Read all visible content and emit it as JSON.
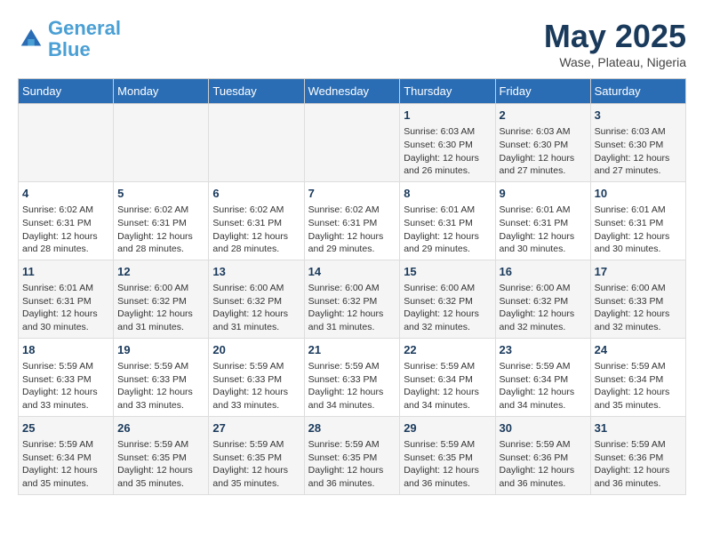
{
  "header": {
    "logo_line1": "General",
    "logo_line2": "Blue",
    "month": "May 2025",
    "location": "Wase, Plateau, Nigeria"
  },
  "days_of_week": [
    "Sunday",
    "Monday",
    "Tuesday",
    "Wednesday",
    "Thursday",
    "Friday",
    "Saturday"
  ],
  "weeks": [
    [
      {
        "day": "",
        "info": ""
      },
      {
        "day": "",
        "info": ""
      },
      {
        "day": "",
        "info": ""
      },
      {
        "day": "",
        "info": ""
      },
      {
        "day": "1",
        "info": "Sunrise: 6:03 AM\nSunset: 6:30 PM\nDaylight: 12 hours and 26 minutes."
      },
      {
        "day": "2",
        "info": "Sunrise: 6:03 AM\nSunset: 6:30 PM\nDaylight: 12 hours and 27 minutes."
      },
      {
        "day": "3",
        "info": "Sunrise: 6:03 AM\nSunset: 6:30 PM\nDaylight: 12 hours and 27 minutes."
      }
    ],
    [
      {
        "day": "4",
        "info": "Sunrise: 6:02 AM\nSunset: 6:31 PM\nDaylight: 12 hours and 28 minutes."
      },
      {
        "day": "5",
        "info": "Sunrise: 6:02 AM\nSunset: 6:31 PM\nDaylight: 12 hours and 28 minutes."
      },
      {
        "day": "6",
        "info": "Sunrise: 6:02 AM\nSunset: 6:31 PM\nDaylight: 12 hours and 28 minutes."
      },
      {
        "day": "7",
        "info": "Sunrise: 6:02 AM\nSunset: 6:31 PM\nDaylight: 12 hours and 29 minutes."
      },
      {
        "day": "8",
        "info": "Sunrise: 6:01 AM\nSunset: 6:31 PM\nDaylight: 12 hours and 29 minutes."
      },
      {
        "day": "9",
        "info": "Sunrise: 6:01 AM\nSunset: 6:31 PM\nDaylight: 12 hours and 30 minutes."
      },
      {
        "day": "10",
        "info": "Sunrise: 6:01 AM\nSunset: 6:31 PM\nDaylight: 12 hours and 30 minutes."
      }
    ],
    [
      {
        "day": "11",
        "info": "Sunrise: 6:01 AM\nSunset: 6:31 PM\nDaylight: 12 hours and 30 minutes."
      },
      {
        "day": "12",
        "info": "Sunrise: 6:00 AM\nSunset: 6:32 PM\nDaylight: 12 hours and 31 minutes."
      },
      {
        "day": "13",
        "info": "Sunrise: 6:00 AM\nSunset: 6:32 PM\nDaylight: 12 hours and 31 minutes."
      },
      {
        "day": "14",
        "info": "Sunrise: 6:00 AM\nSunset: 6:32 PM\nDaylight: 12 hours and 31 minutes."
      },
      {
        "day": "15",
        "info": "Sunrise: 6:00 AM\nSunset: 6:32 PM\nDaylight: 12 hours and 32 minutes."
      },
      {
        "day": "16",
        "info": "Sunrise: 6:00 AM\nSunset: 6:32 PM\nDaylight: 12 hours and 32 minutes."
      },
      {
        "day": "17",
        "info": "Sunrise: 6:00 AM\nSunset: 6:33 PM\nDaylight: 12 hours and 32 minutes."
      }
    ],
    [
      {
        "day": "18",
        "info": "Sunrise: 5:59 AM\nSunset: 6:33 PM\nDaylight: 12 hours and 33 minutes."
      },
      {
        "day": "19",
        "info": "Sunrise: 5:59 AM\nSunset: 6:33 PM\nDaylight: 12 hours and 33 minutes."
      },
      {
        "day": "20",
        "info": "Sunrise: 5:59 AM\nSunset: 6:33 PM\nDaylight: 12 hours and 33 minutes."
      },
      {
        "day": "21",
        "info": "Sunrise: 5:59 AM\nSunset: 6:33 PM\nDaylight: 12 hours and 34 minutes."
      },
      {
        "day": "22",
        "info": "Sunrise: 5:59 AM\nSunset: 6:34 PM\nDaylight: 12 hours and 34 minutes."
      },
      {
        "day": "23",
        "info": "Sunrise: 5:59 AM\nSunset: 6:34 PM\nDaylight: 12 hours and 34 minutes."
      },
      {
        "day": "24",
        "info": "Sunrise: 5:59 AM\nSunset: 6:34 PM\nDaylight: 12 hours and 35 minutes."
      }
    ],
    [
      {
        "day": "25",
        "info": "Sunrise: 5:59 AM\nSunset: 6:34 PM\nDaylight: 12 hours and 35 minutes."
      },
      {
        "day": "26",
        "info": "Sunrise: 5:59 AM\nSunset: 6:35 PM\nDaylight: 12 hours and 35 minutes."
      },
      {
        "day": "27",
        "info": "Sunrise: 5:59 AM\nSunset: 6:35 PM\nDaylight: 12 hours and 35 minutes."
      },
      {
        "day": "28",
        "info": "Sunrise: 5:59 AM\nSunset: 6:35 PM\nDaylight: 12 hours and 36 minutes."
      },
      {
        "day": "29",
        "info": "Sunrise: 5:59 AM\nSunset: 6:35 PM\nDaylight: 12 hours and 36 minutes."
      },
      {
        "day": "30",
        "info": "Sunrise: 5:59 AM\nSunset: 6:36 PM\nDaylight: 12 hours and 36 minutes."
      },
      {
        "day": "31",
        "info": "Sunrise: 5:59 AM\nSunset: 6:36 PM\nDaylight: 12 hours and 36 minutes."
      }
    ]
  ]
}
